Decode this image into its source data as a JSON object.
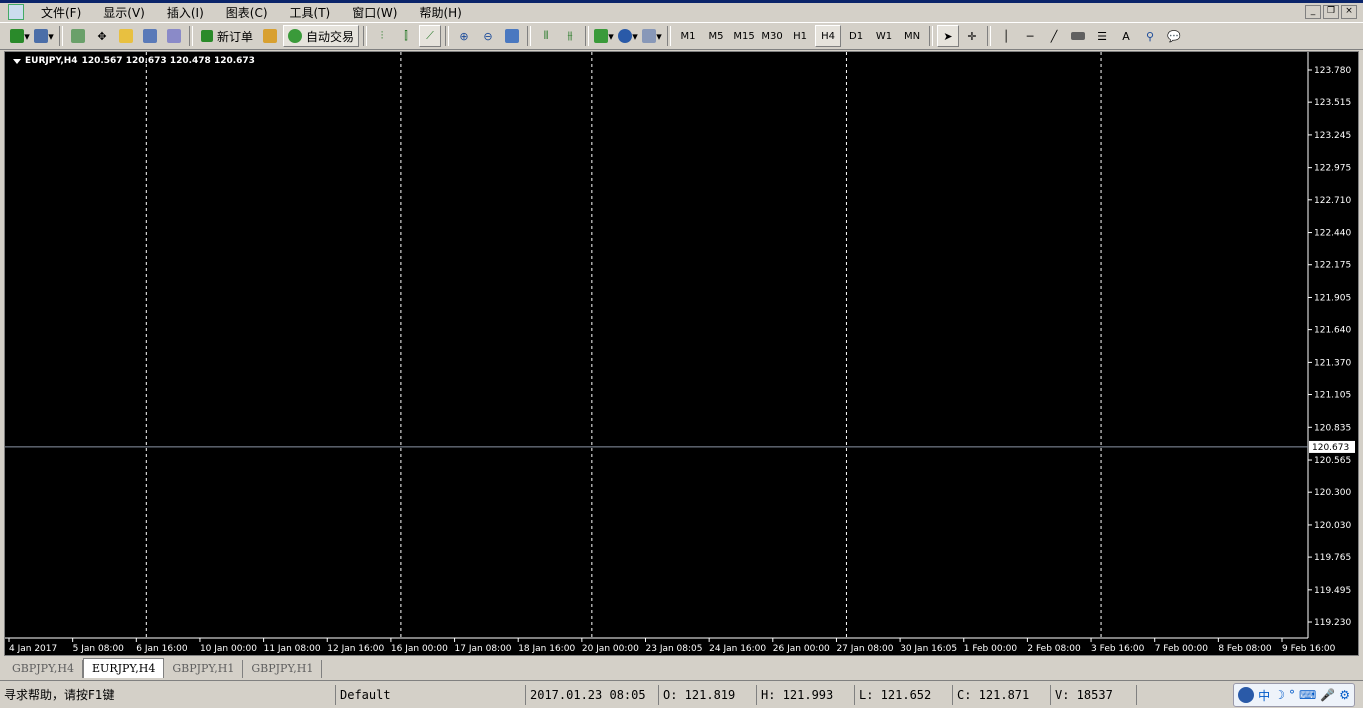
{
  "menu": [
    "文件(F)",
    "显示(V)",
    "插入(I)",
    "图表(C)",
    "工具(T)",
    "窗口(W)",
    "帮助(H)"
  ],
  "toolbar": {
    "new_order": "新订单",
    "auto_trading": "自动交易",
    "timeframes": [
      "M1",
      "M5",
      "M15",
      "M30",
      "H1",
      "H4",
      "D1",
      "W1",
      "MN"
    ],
    "active_timeframe": "H4"
  },
  "chart": {
    "symbol_label": "EURJPY,H4",
    "ohlc_label": "120.567 120.673 120.478 120.673",
    "current_price": "120.673",
    "price_ticks": [
      "123.780",
      "123.515",
      "123.245",
      "122.975",
      "122.710",
      "122.440",
      "122.175",
      "121.905",
      "121.640",
      "121.370",
      "121.105",
      "120.835",
      "120.565",
      "120.300",
      "120.030",
      "119.765",
      "119.495",
      "119.230"
    ],
    "time_ticks": [
      "4 Jan 2017",
      "5 Jan 08:00",
      "6 Jan 16:00",
      "10 Jan 00:00",
      "11 Jan 08:00",
      "12 Jan 16:00",
      "16 Jan 00:00",
      "17 Jan 08:00",
      "18 Jan 16:00",
      "20 Jan 00:00",
      "23 Jan 08:05",
      "24 Jan 16:00",
      "26 Jan 00:00",
      "27 Jan 08:00",
      "30 Jan 16:05",
      "1 Feb 00:00",
      "2 Feb 08:00",
      "3 Feb 16:00",
      "7 Feb 00:00",
      "8 Feb 08:00",
      "9 Feb 16:00"
    ],
    "colors": {
      "background": "#000000",
      "bull": "#00ff00",
      "bear": "#ff0000",
      "grid": "#ffffff",
      "bid_line": "#8c96a6"
    }
  },
  "tabs": [
    "GBPJPY,H4",
    "EURJPY,H4",
    "GBPJPY,H1",
    "GBPJPY,H1"
  ],
  "active_tab": "EURJPY,H4",
  "status": {
    "help": "寻求帮助，请按F1键",
    "profile": "Default",
    "time": "2017.01.23 08:05",
    "open": "O: 121.819",
    "high": "H: 121.993",
    "low": "L: 121.652",
    "close": "C: 121.871",
    "volume": "V: 18537"
  },
  "ime": {
    "label": "中"
  }
}
